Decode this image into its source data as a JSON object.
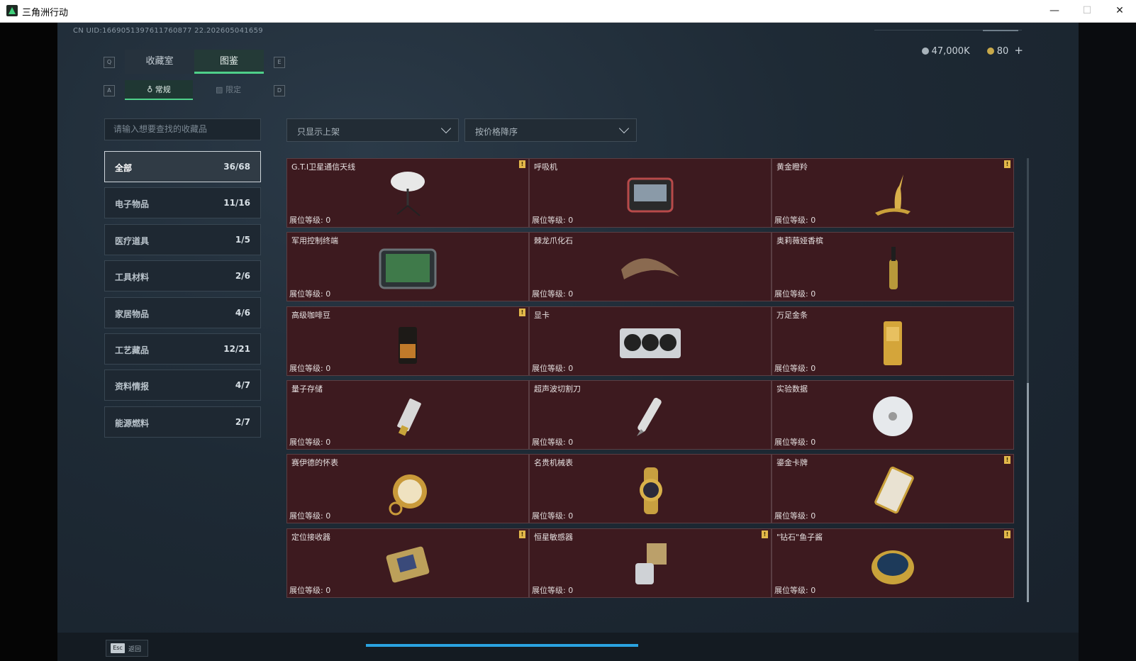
{
  "window": {
    "title": "三角洲行动",
    "min_glyph": "—",
    "max_glyph": "☐",
    "close_glyph": "✕"
  },
  "uid": "CN UID:1669051397611760877 22.202605041659",
  "currency": {
    "silver": "47,000K",
    "gold": "80",
    "plus": "+"
  },
  "keys": {
    "q": "Q",
    "e": "E",
    "a": "A",
    "d": "D"
  },
  "tabs": {
    "collection": "收藏室",
    "catalog": "图鉴"
  },
  "subtabs": {
    "normal_icon": "♁",
    "normal": "常规",
    "limited_icon": "▨",
    "limited": "限定"
  },
  "search": {
    "placeholder": "请输入想要查找的收藏品"
  },
  "categories": [
    {
      "label": "全部",
      "count": "36/68"
    },
    {
      "label": "电子物品",
      "count": "11/16"
    },
    {
      "label": "医疗道具",
      "count": "1/5"
    },
    {
      "label": "工具材料",
      "count": "2/6"
    },
    {
      "label": "家居物品",
      "count": "4/6"
    },
    {
      "label": "工艺藏品",
      "count": "12/21"
    },
    {
      "label": "资料情报",
      "count": "4/7"
    },
    {
      "label": "能源燃料",
      "count": "2/7"
    }
  ],
  "filters": {
    "display": "只显示上架",
    "sort": "按价格降序"
  },
  "items": [
    {
      "name": "G.T.I卫星通信天线",
      "level": "展位等级: 0",
      "badge": "!",
      "icon": "satellite-dish-icon"
    },
    {
      "name": "呼吸机",
      "level": "展位等级: 0",
      "badge": "",
      "icon": "ventilator-icon"
    },
    {
      "name": "黄金瞪羚",
      "level": "展位等级: 0",
      "badge": "!",
      "icon": "golden-gazelle-icon"
    },
    {
      "name": "军用控制终端",
      "level": "展位等级: 0",
      "badge": "",
      "icon": "control-terminal-icon"
    },
    {
      "name": "棘龙爪化石",
      "level": "展位等级: 0",
      "badge": "",
      "icon": "claw-fossil-icon"
    },
    {
      "name": "奥莉薇娅香槟",
      "level": "展位等级: 0",
      "badge": "",
      "icon": "champagne-bottle-icon"
    },
    {
      "name": "高级咖啡豆",
      "level": "展位等级: 0",
      "badge": "!",
      "icon": "coffee-bag-icon"
    },
    {
      "name": "显卡",
      "level": "展位等级: 0",
      "badge": "",
      "icon": "graphics-card-icon"
    },
    {
      "name": "万足金条",
      "level": "展位等级: 0",
      "badge": "",
      "icon": "gold-bar-icon"
    },
    {
      "name": "量子存储",
      "level": "展位等级: 0",
      "badge": "",
      "icon": "usb-drive-icon"
    },
    {
      "name": "超声波切割刀",
      "level": "展位等级: 0",
      "badge": "",
      "icon": "ultrasonic-knife-icon"
    },
    {
      "name": "实验数据",
      "level": "展位等级: 0",
      "badge": "",
      "icon": "data-disc-icon"
    },
    {
      "name": "赛伊德的怀表",
      "level": "展位等级: 0",
      "badge": "",
      "icon": "pocket-watch-icon"
    },
    {
      "name": "名贵机械表",
      "level": "展位等级: 0",
      "badge": "",
      "icon": "wristwatch-icon"
    },
    {
      "name": "鎏金卡牌",
      "level": "展位等级: 0",
      "badge": "!",
      "icon": "gilded-card-icon"
    },
    {
      "name": "定位接收器",
      "level": "展位等级: 0",
      "badge": "!",
      "icon": "gps-receiver-icon"
    },
    {
      "name": "恒星敏感器",
      "level": "展位等级: 0",
      "badge": "!",
      "icon": "star-sensor-icon"
    },
    {
      "name": "\"钻石\"鱼子酱",
      "level": "展位等级: 0",
      "badge": "!",
      "icon": "caviar-tin-icon"
    }
  ],
  "bottom": {
    "esc": "Esc",
    "back": "返回"
  },
  "colors": {
    "accent": "#4fd08a",
    "card_bg": "#3d1a1f",
    "badge": "#e2b84a",
    "progress": "#2aa3e0"
  }
}
